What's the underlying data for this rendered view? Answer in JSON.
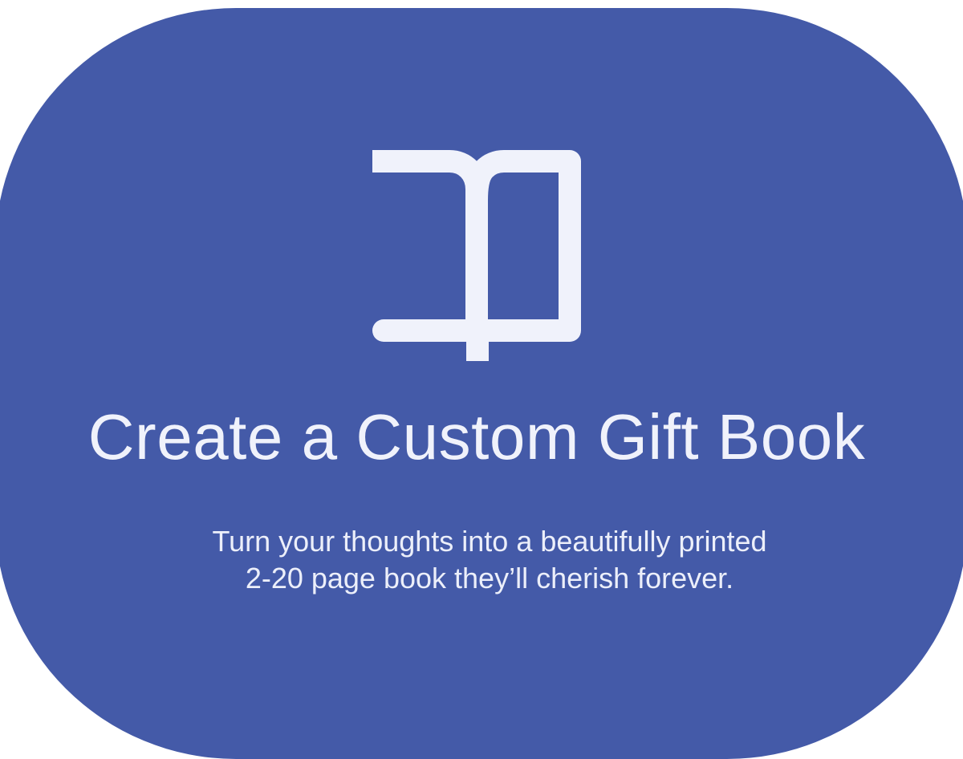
{
  "hero": {
    "icon": "book-open-icon",
    "title": "Create a Custom Gift Book",
    "subtitle_line_1": "Turn your thoughts into a beautifully printed",
    "subtitle_line_2": "2-20 page book they’ll cherish forever."
  },
  "colors": {
    "card_background": "#445aa8",
    "foreground": "#f0f2fb"
  }
}
